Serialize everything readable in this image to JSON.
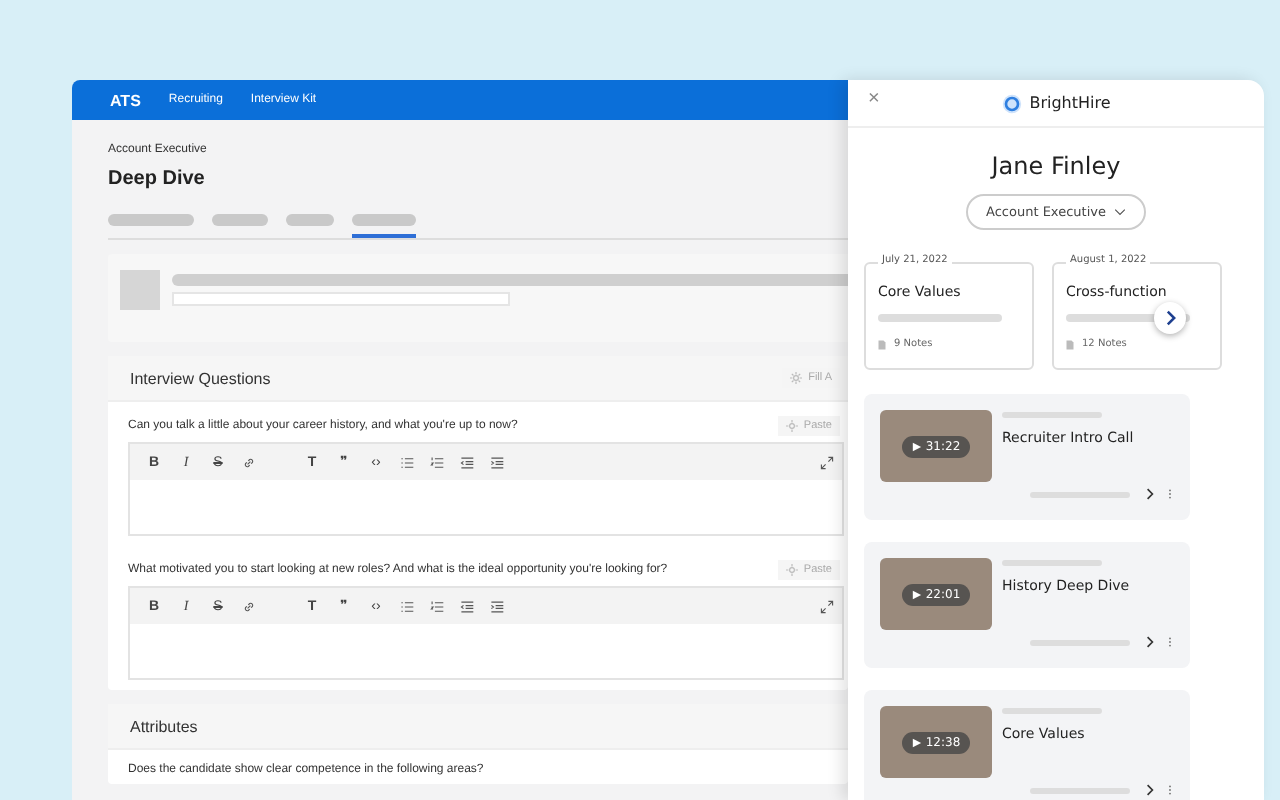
{
  "ats": {
    "brand": "ATS",
    "nav": [
      "Recruiting",
      "Interview Kit"
    ],
    "job": "Account Executive",
    "title": "Deep Dive",
    "tabs": [
      {
        "selected": false
      },
      {
        "selected": false
      },
      {
        "selected": false
      },
      {
        "selected": true
      }
    ],
    "questions_section": {
      "title": "Interview Questions",
      "action": "Fill A",
      "questions": [
        {
          "text": "Can you talk a little about your career history, and what you're up to now?",
          "action": "Paste",
          "toolbar": [
            {
              "kind": "bold",
              "label": "B"
            },
            {
              "kind": "italic",
              "label": "I"
            },
            {
              "kind": "strike",
              "label": "S"
            },
            {
              "kind": "link"
            },
            {
              "kind": "heading",
              "label": "T"
            },
            {
              "kind": "quote",
              "label": "❞"
            },
            {
              "kind": "code",
              "label": "‹›"
            },
            {
              "kind": "bullets"
            },
            {
              "kind": "numbers"
            },
            {
              "kind": "outdent"
            },
            {
              "kind": "indent"
            }
          ]
        },
        {
          "text": "What motivated you to start looking at new roles? And what is the ideal opportunity you're looking for?",
          "action": "Paste",
          "toolbar": [
            {
              "kind": "bold",
              "label": "B"
            },
            {
              "kind": "italic",
              "label": "I"
            },
            {
              "kind": "strike",
              "label": "S"
            },
            {
              "kind": "link"
            },
            {
              "kind": "heading",
              "label": "T"
            },
            {
              "kind": "quote",
              "label": "❞"
            },
            {
              "kind": "code",
              "label": "‹›"
            },
            {
              "kind": "bullets"
            },
            {
              "kind": "numbers"
            },
            {
              "kind": "outdent"
            },
            {
              "kind": "indent"
            }
          ]
        }
      ]
    },
    "attributes": {
      "title": "Attributes",
      "prompt": "Does the candidate show clear competence in the following areas?"
    }
  },
  "panel": {
    "close": "×",
    "brand": "BrightHire",
    "candidate": "Jane Finley",
    "role": "Account Executive",
    "interviews": [
      {
        "date": "July 21, 2022",
        "title": "Core Values",
        "notes": "9 Notes"
      },
      {
        "date": "August 1, 2022",
        "title": "Cross-function",
        "notes": "12 Notes"
      }
    ],
    "recordings": [
      {
        "title": "Recruiter Intro Call",
        "duration": "31:22"
      },
      {
        "title": "History Deep Dive",
        "duration": "22:01"
      },
      {
        "title": "Core Values",
        "duration": "12:38"
      }
    ]
  }
}
